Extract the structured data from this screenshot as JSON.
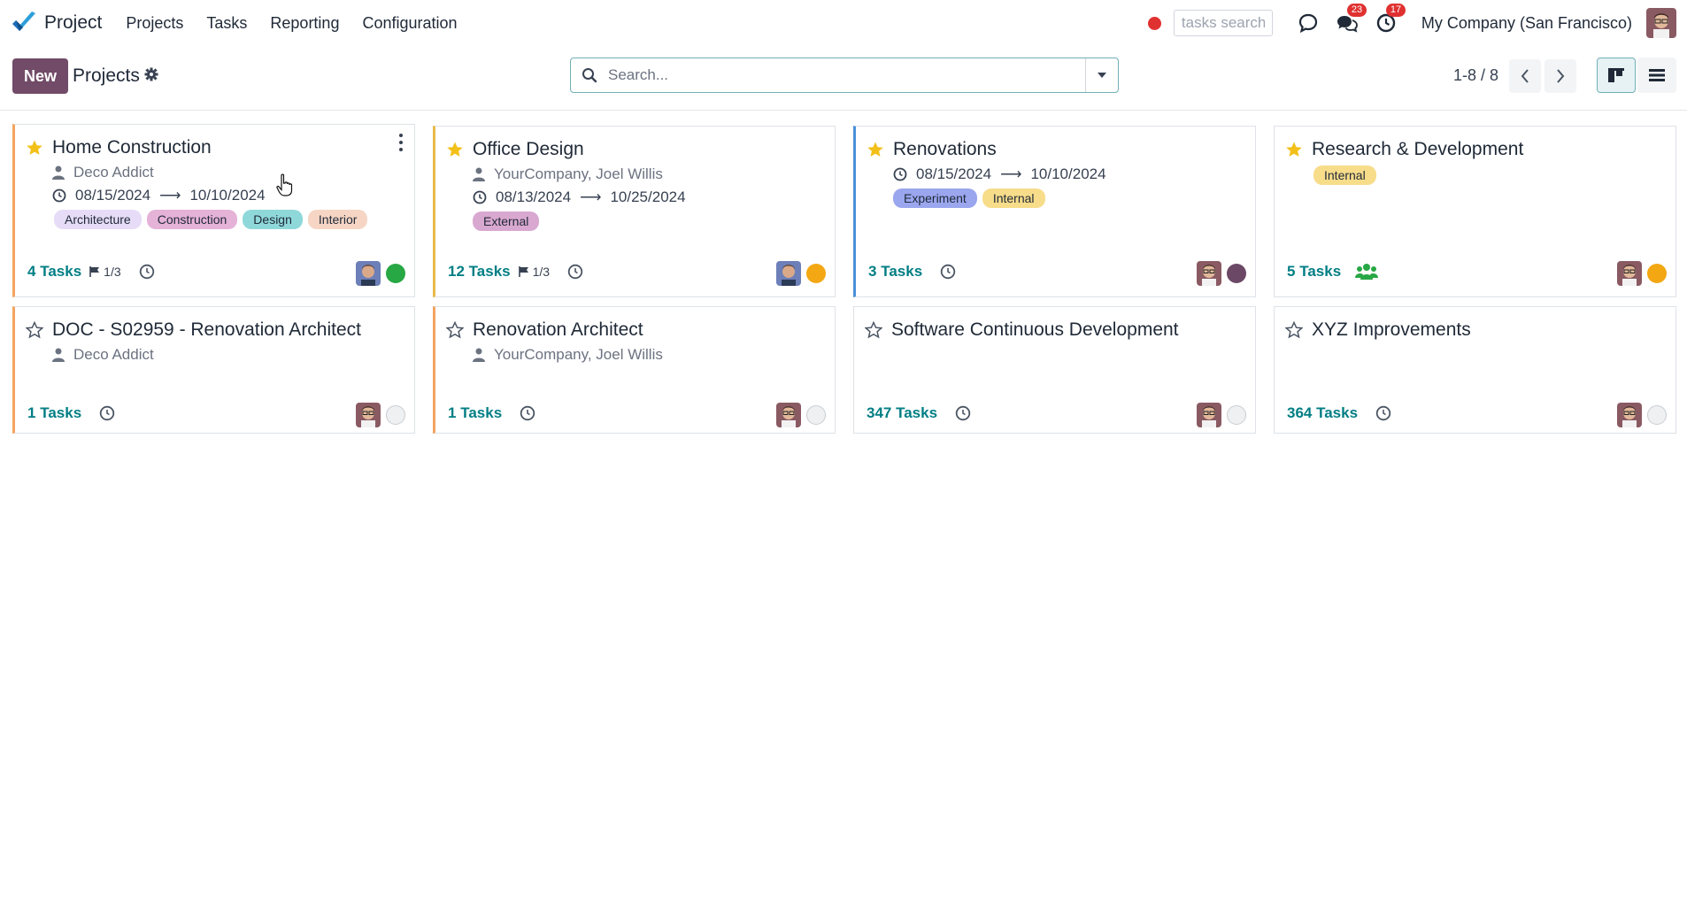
{
  "nav": {
    "app_name": "Project",
    "menu": [
      "Projects",
      "Tasks",
      "Reporting",
      "Configuration"
    ],
    "tasks_search_placeholder": "tasks search",
    "messages_badge": "23",
    "activities_badge": "17",
    "company": "My Company (San Francisco)"
  },
  "control": {
    "new_label": "New",
    "title": "Projects",
    "search_placeholder": "Search...",
    "pager": "1-8 / 8"
  },
  "colors": {
    "brand": "#714b67",
    "link": "#017e84",
    "status_green": "#28a745",
    "status_orange": "#f3a712",
    "status_purple": "#6b4865"
  },
  "cards": [
    {
      "title": "Home Construction",
      "favorite": true,
      "customer": "Deco Addict",
      "date_start": "08/15/2024",
      "date_end": "10/10/2024",
      "tags": [
        "Architecture",
        "Construction",
        "Design",
        "Interior"
      ],
      "tasks_count": "4",
      "tasks_word": "Tasks",
      "milestone": "1/3",
      "status": "green"
    },
    {
      "title": "Office Design",
      "favorite": true,
      "customer": "YourCompany, Joel Willis",
      "date_start": "08/13/2024",
      "date_end": "10/25/2024",
      "tags": [
        "External"
      ],
      "tasks_count": "12",
      "tasks_word": "Tasks",
      "milestone": "1/3",
      "status": "orange"
    },
    {
      "title": "Renovations",
      "favorite": true,
      "date_start": "08/15/2024",
      "date_end": "10/10/2024",
      "tags": [
        "Experiment",
        "Internal"
      ],
      "tasks_count": "3",
      "tasks_word": "Tasks",
      "status": "purple"
    },
    {
      "title": "Research & Development",
      "favorite": true,
      "tags": [
        "Internal"
      ],
      "tasks_count": "5",
      "tasks_word": "Tasks",
      "status": "orange"
    },
    {
      "title": "DOC - S02959 - Renovation Architect",
      "favorite": false,
      "customer": "Deco Addict",
      "tasks_count": "1",
      "tasks_word": "Tasks",
      "status": "none"
    },
    {
      "title": "Renovation Architect",
      "favorite": false,
      "customer": "YourCompany, Joel Willis",
      "tasks_count": "1",
      "tasks_word": "Tasks",
      "status": "none"
    },
    {
      "title": "Software Continuous Development",
      "favorite": false,
      "tasks_count": "347",
      "tasks_word": "Tasks",
      "status": "none"
    },
    {
      "title": "XYZ Improvements",
      "favorite": false,
      "tasks_count": "364",
      "tasks_word": "Tasks",
      "status": "none"
    }
  ]
}
